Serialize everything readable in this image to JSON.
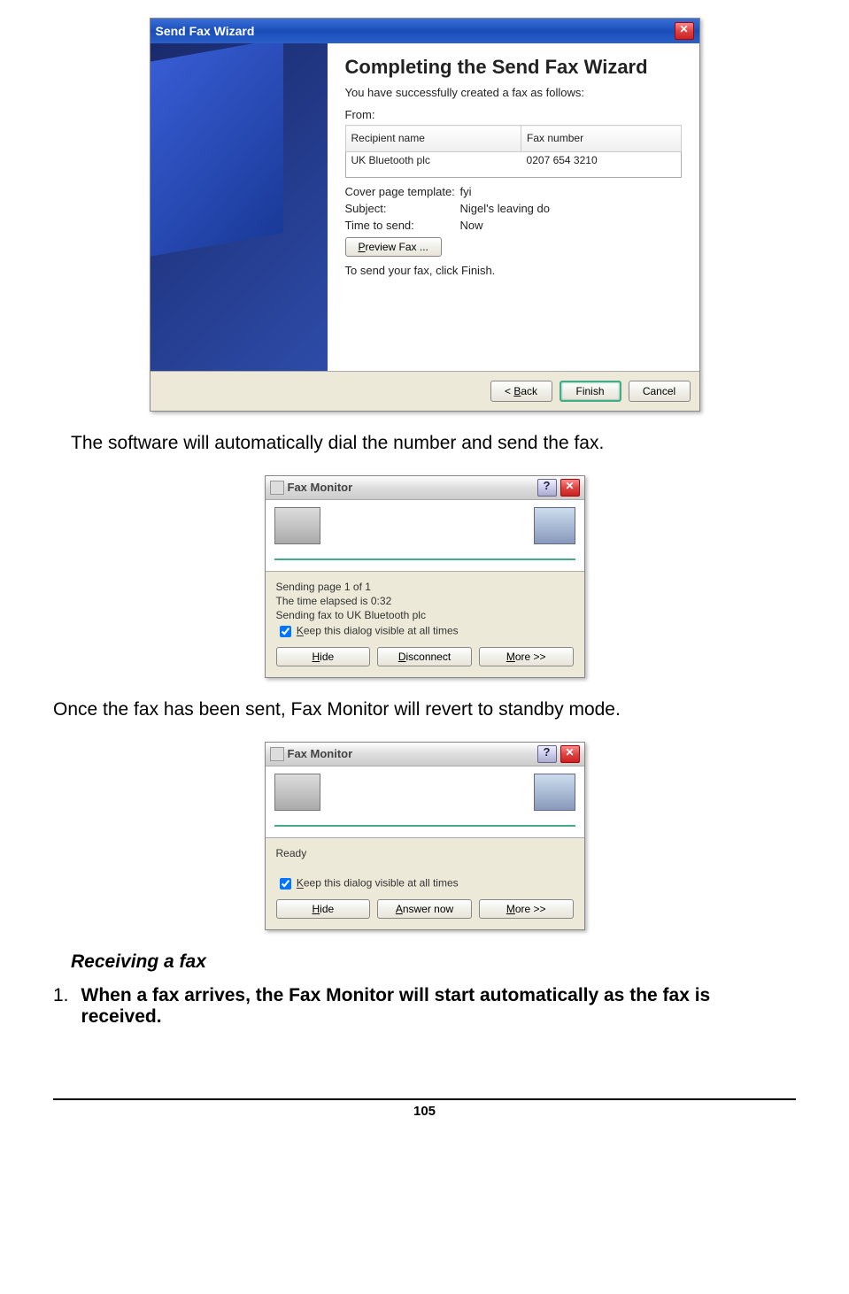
{
  "wizard": {
    "title": "Send Fax Wizard",
    "heading": "Completing the Send Fax Wizard",
    "sub": "You have successfully created a fax as follows:",
    "from_label": "From:",
    "table": {
      "h1": "Recipient name",
      "h2": "Fax number",
      "c1": "UK Bluetooth plc",
      "c2": "0207 654 3210"
    },
    "cover_k": "Cover page template:",
    "cover_v": "fyi",
    "subject_k": "Subject:",
    "subject_v": "Nigel's leaving do",
    "time_k": "Time to send:",
    "time_v": "Now",
    "preview": "Preview Fax ...",
    "instr": "To send your fax, click Finish.",
    "back": "< Back",
    "finish": "Finish",
    "cancel": "Cancel"
  },
  "text1": "The software will automatically dial the number and send the fax.",
  "monitor1": {
    "title": "Fax Monitor",
    "l1": "Sending page 1 of 1",
    "l2": "The time elapsed is 0:32",
    "l3": "Sending fax to UK Bluetooth plc",
    "keep": "Keep this dialog visible at all times",
    "b1": "Hide",
    "b2": "Disconnect",
    "b3": "More >>"
  },
  "text2": "Once the fax has been sent, Fax Monitor will revert to standby mode.",
  "monitor2": {
    "title": "Fax Monitor",
    "l1": "Ready",
    "keep": "Keep this dialog visible at all times",
    "b1": "Hide",
    "b2": "Answer now",
    "b3": "More >>"
  },
  "heading2": "Receiving a fax",
  "step1_num": "1.",
  "step1": "When a fax arrives, the Fax Monitor will start automatically as the fax is received.",
  "page_num": "105"
}
